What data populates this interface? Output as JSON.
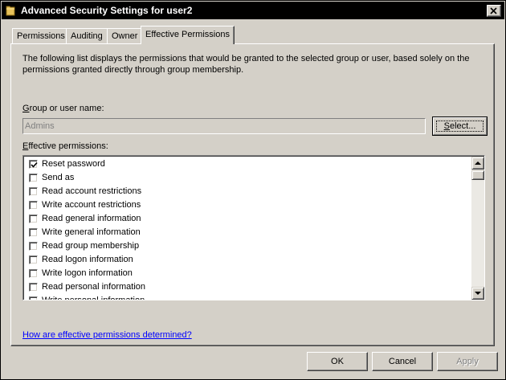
{
  "window": {
    "title": "Advanced Security Settings for user2",
    "icon": "folder-icon"
  },
  "tabs": [
    {
      "label": "Permissions",
      "active": false
    },
    {
      "label": "Auditing",
      "active": false
    },
    {
      "label": "Owner",
      "active": false
    },
    {
      "label": "Effective Permissions",
      "active": true
    }
  ],
  "panel": {
    "description": "The following list displays the permissions that would be granted to the selected group or user, based solely on the permissions granted directly through group membership.",
    "group_label_prefix": "G",
    "group_label_rest": "roup or user name:",
    "group_value": "Admins",
    "select_button_label_u": "S",
    "select_button_label_rest": "elect...",
    "effective_label_prefix": "E",
    "effective_label_rest": "ffective permissions:",
    "permissions": [
      {
        "label": "Reset password",
        "checked": true
      },
      {
        "label": "Send as",
        "checked": false
      },
      {
        "label": "Read account restrictions",
        "checked": false
      },
      {
        "label": "Write account restrictions",
        "checked": false
      },
      {
        "label": "Read general information",
        "checked": false
      },
      {
        "label": "Write general information",
        "checked": false
      },
      {
        "label": "Read group membership",
        "checked": false
      },
      {
        "label": "Read logon information",
        "checked": false
      },
      {
        "label": "Write logon information",
        "checked": false
      },
      {
        "label": "Read personal information",
        "checked": false
      },
      {
        "label": "Write personal information",
        "checked": false
      }
    ],
    "help_link": "How are effective permissions determined?"
  },
  "buttons": {
    "ok": "OK",
    "cancel": "Cancel",
    "apply": "Apply"
  }
}
